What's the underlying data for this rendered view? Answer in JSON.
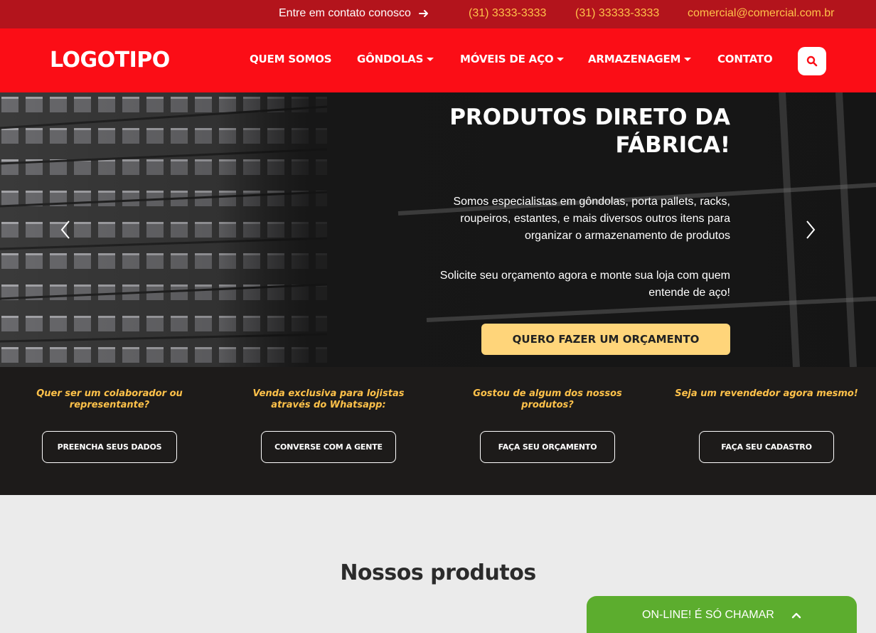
{
  "topbar": {
    "contact_cta": "Entre em contato conosco",
    "phone_1": "(31) 3333-3333",
    "phone_2": "(31) 33333-3333",
    "email": "comercial@comercial.com.br"
  },
  "header": {
    "logo": "LOGOTIPO",
    "nav": [
      {
        "label": "QUEM SOMOS",
        "dropdown": false
      },
      {
        "label": "GÔNDOLAS",
        "dropdown": true
      },
      {
        "label": "MÓVEIS DE AÇO",
        "dropdown": true
      },
      {
        "label": "ARMAZENAGEM",
        "dropdown": true
      },
      {
        "label": "CONTATO",
        "dropdown": false
      }
    ]
  },
  "hero": {
    "title": "PRODUTOS DIRETO DA FÁBRICA!",
    "paragraph_1": "Somos especialistas em gôndolas, porta pallets, racks, roupeiros, estantes, e mais diversos outros itens para organizar o armazenamento de produtos",
    "paragraph_2": "Solicite seu orçamento agora e monte sua loja com quem entende de aço!",
    "cta": "QUERO FAZER UM ORÇAMENTO"
  },
  "band": {
    "items": [
      {
        "question": "Quer ser um colaborador ou representante?",
        "button": "PREENCHA SEUS DADOS"
      },
      {
        "question": "Venda exclusiva para lojistas através do Whatsapp:",
        "button": "CONVERSE COM A GENTE"
      },
      {
        "question": "Gostou de algum dos nossos produtos?",
        "button": "FAÇA SEU ORÇAMENTO"
      },
      {
        "question": "Seja um revendedor agora mesmo!",
        "button": "FAÇA SEU CADASTRO"
      }
    ]
  },
  "products": {
    "title": "Nossos produtos"
  },
  "chat": {
    "label": "ON-LINE! É SÓ CHAMAR"
  },
  "colors": {
    "topbar_bg": "#b3141c",
    "header_bg": "#fb0d16",
    "accent_yellow": "#ffc24a",
    "cta_bg": "#ffd57a",
    "band_bg": "#1d1b1a",
    "chat_bg": "#5cad2e"
  },
  "icons": {
    "contact_arrow": "arrow-right-icon",
    "search": "search-icon",
    "prev": "chevron-left-icon",
    "next": "chevron-right-icon",
    "chat_toggle": "chevron-up-icon"
  }
}
